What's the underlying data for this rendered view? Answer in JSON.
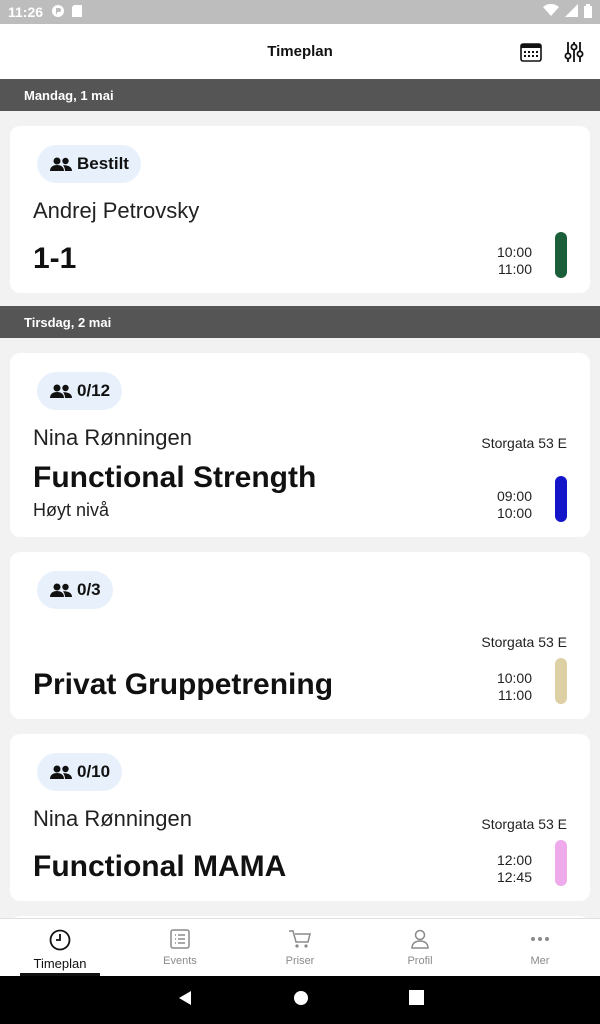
{
  "status_bar": {
    "time": "11:26"
  },
  "app_bar": {
    "title": "Timeplan"
  },
  "days": [
    {
      "label": "Mandag, 1 mai",
      "sessions": [
        {
          "badge": "Bestilt",
          "instructor": "Andrej Petrovsky",
          "location": "",
          "name": "1-1",
          "level": "",
          "start": "10:00",
          "end": "11:00",
          "color": "#1b5e3a"
        }
      ]
    },
    {
      "label": "Tirsdag, 2 mai",
      "sessions": [
        {
          "badge": "0/12",
          "instructor": "Nina Rønningen",
          "location": "Storgata 53 E",
          "name": "Functional Strength",
          "level": "Høyt nivå",
          "start": "09:00",
          "end": "10:00",
          "color": "#1414c8"
        },
        {
          "badge": "0/3",
          "instructor": "",
          "location": "Storgata 53 E",
          "name": "Privat Gruppetrening",
          "level": "",
          "start": "10:00",
          "end": "11:00",
          "color": "#ddd0a4"
        },
        {
          "badge": "0/10",
          "instructor": "Nina Rønningen",
          "location": "Storgata 53 E",
          "name": "Functional MAMA",
          "level": "",
          "start": "12:00",
          "end": "12:45",
          "color": "#eeaaea"
        }
      ]
    }
  ],
  "bottom_nav": [
    {
      "label": "Timeplan",
      "icon": "clock-icon",
      "active": true
    },
    {
      "label": "Events",
      "icon": "list-icon",
      "active": false
    },
    {
      "label": "Priser",
      "icon": "cart-icon",
      "active": false
    },
    {
      "label": "Profil",
      "icon": "person-icon",
      "active": false
    },
    {
      "label": "Mer",
      "icon": "more-icon",
      "active": false
    }
  ]
}
